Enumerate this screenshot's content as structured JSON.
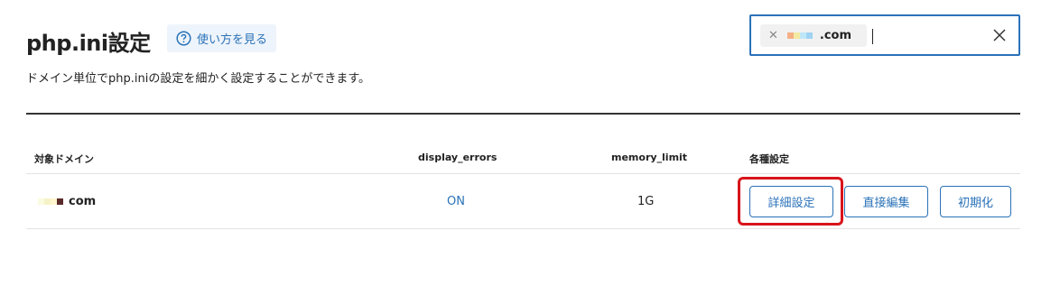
{
  "header": {
    "title": "php.ini設定",
    "help_label": "使い方を見る",
    "description": "ドメイン単位でphp.iniの設定を細かく設定することができます。"
  },
  "search": {
    "chip_label": ".com",
    "chip_blur_colors": [
      "#f5b087",
      "#f3eaa2",
      "#bfe7f7",
      "#9fd3f3"
    ]
  },
  "table": {
    "columns": [
      "対象ドメイン",
      "display_errors",
      "memory_limit",
      "各種設定"
    ],
    "rows": [
      {
        "domain": "com",
        "display_errors": "ON",
        "memory_limit": "1G"
      }
    ],
    "actions": [
      "詳細設定",
      "直接編集",
      "初期化"
    ]
  },
  "colors": {
    "accent": "#2a72b8",
    "highlight": "#d8141b"
  }
}
